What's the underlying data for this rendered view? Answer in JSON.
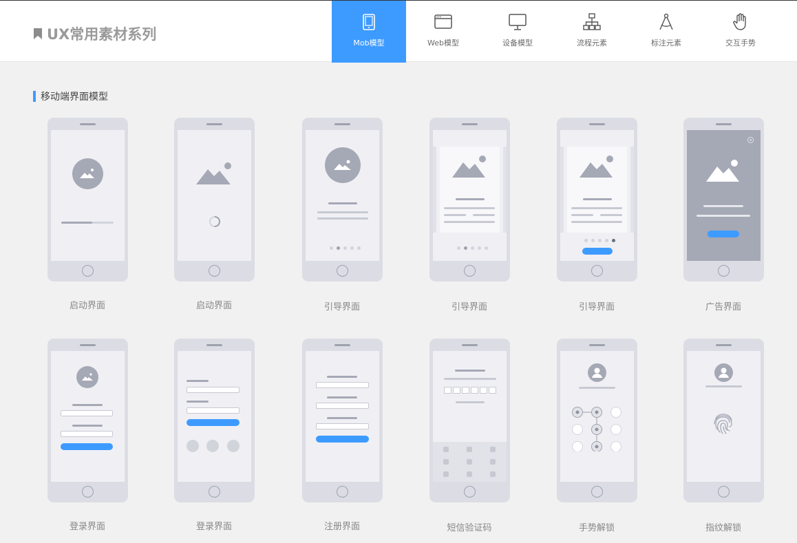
{
  "header": {
    "logo_text": "UX常用素材系列",
    "tabs": [
      {
        "label": "Mob模型",
        "icon": "tablet-icon",
        "active": true
      },
      {
        "label": "Web模型",
        "icon": "browser-window-icon",
        "active": false
      },
      {
        "label": "设备模型",
        "icon": "monitor-icon",
        "active": false
      },
      {
        "label": "流程元素",
        "icon": "flowchart-icon",
        "active": false
      },
      {
        "label": "标注元素",
        "icon": "compass-drafting-icon",
        "active": false
      },
      {
        "label": "交互手势",
        "icon": "hand-gesture-icon",
        "active": false
      }
    ]
  },
  "section": {
    "title": "移动端界面模型"
  },
  "cards": [
    {
      "label": "启动界面"
    },
    {
      "label": "启动界面"
    },
    {
      "label": "引导界面"
    },
    {
      "label": "引导界面"
    },
    {
      "label": "引导界面"
    },
    {
      "label": "广告界面"
    },
    {
      "label": "登录界面"
    },
    {
      "label": "登录界面"
    },
    {
      "label": "注册界面"
    },
    {
      "label": "短信验证码"
    },
    {
      "label": "手势解锁"
    },
    {
      "label": "指纹解锁"
    }
  ],
  "colors": {
    "accent": "#3d9bff",
    "phone_body": "#dcdde4",
    "screen": "#f0f0f4",
    "background": "#f1f1f1"
  }
}
